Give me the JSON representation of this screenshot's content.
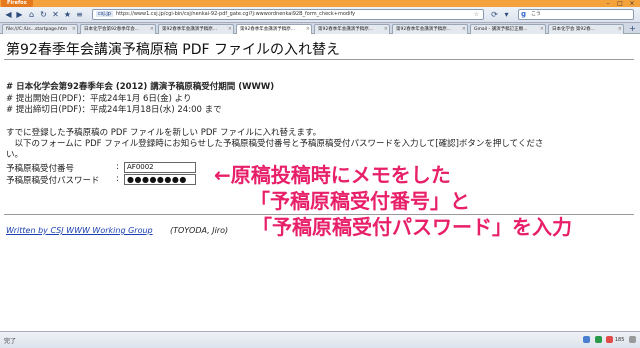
{
  "browser": {
    "app_button": "Firefox",
    "url_domain": "csj.jp",
    "url": "https://www1.csj.jp/cgi-bin/csj/nenkai-92-pdf_gate.cgi?j:wwwordnenkai92B_form_check+modify",
    "search_engine": "g",
    "search_placeholder": "こう",
    "tabs": [
      {
        "label": "file:///C:/Us...startpage.htm"
      },
      {
        "label": "日本化学会第92春季年会..."
      },
      {
        "label": "第92春季年会講演予稿原..."
      },
      {
        "label": "第92春季年会講演予稿原..."
      },
      {
        "label": "第92春季年会講演予稿原..."
      },
      {
        "label": "第92春季年会講演予稿原..."
      },
      {
        "label": "Gmail - 講演予稿訂正願..."
      },
      {
        "label": "日本化学会 第92春..."
      }
    ],
    "status_text": "完了",
    "tray_zoom": "185"
  },
  "page": {
    "title": "第92春季年会講演予稿原稿 PDF ファイルの入れ替え",
    "section_heading": "# 日本化学会第92春季年会 (2012) 講演予稿原稿受付期間 (WWW)",
    "period_start": "# 提出開始日(PDF)：平成24年1月 6日(金) より",
    "period_end": "# 提出締切日(PDF)：平成24年1月18日(水) 24:00 まで",
    "intro1": "すでに登録した予稿原稿の PDF ファイルを新しい PDF ファイルに入れ替えます。",
    "intro2": "　以下のフォームに PDF ファイル登録時にお知らせした予稿原稿受付番号と予稿原稿受付パスワードを入力して[確認]ボタンを押してくださ",
    "intro2b": "い。",
    "form": {
      "number_label": "予稿原稿受付番号",
      "number_value": "AF0002",
      "password_label": "予稿原稿受付パスワード",
      "password_value": "●●●●●●●●",
      "colon": ":"
    },
    "footer_link": "Written by CSJ WWW Working Group",
    "footer_name": "(TOYODA, Jiro)"
  },
  "annotation": {
    "line1": "←原稿投稿時にメモをした",
    "line2": "「予稿原稿受付番号」と",
    "line3": "「予稿原稿受付パスワード」を入力"
  },
  "colors": {
    "accent": "#e8206a",
    "link": "#1a3fb0",
    "titlebar": "#f3a23c"
  }
}
